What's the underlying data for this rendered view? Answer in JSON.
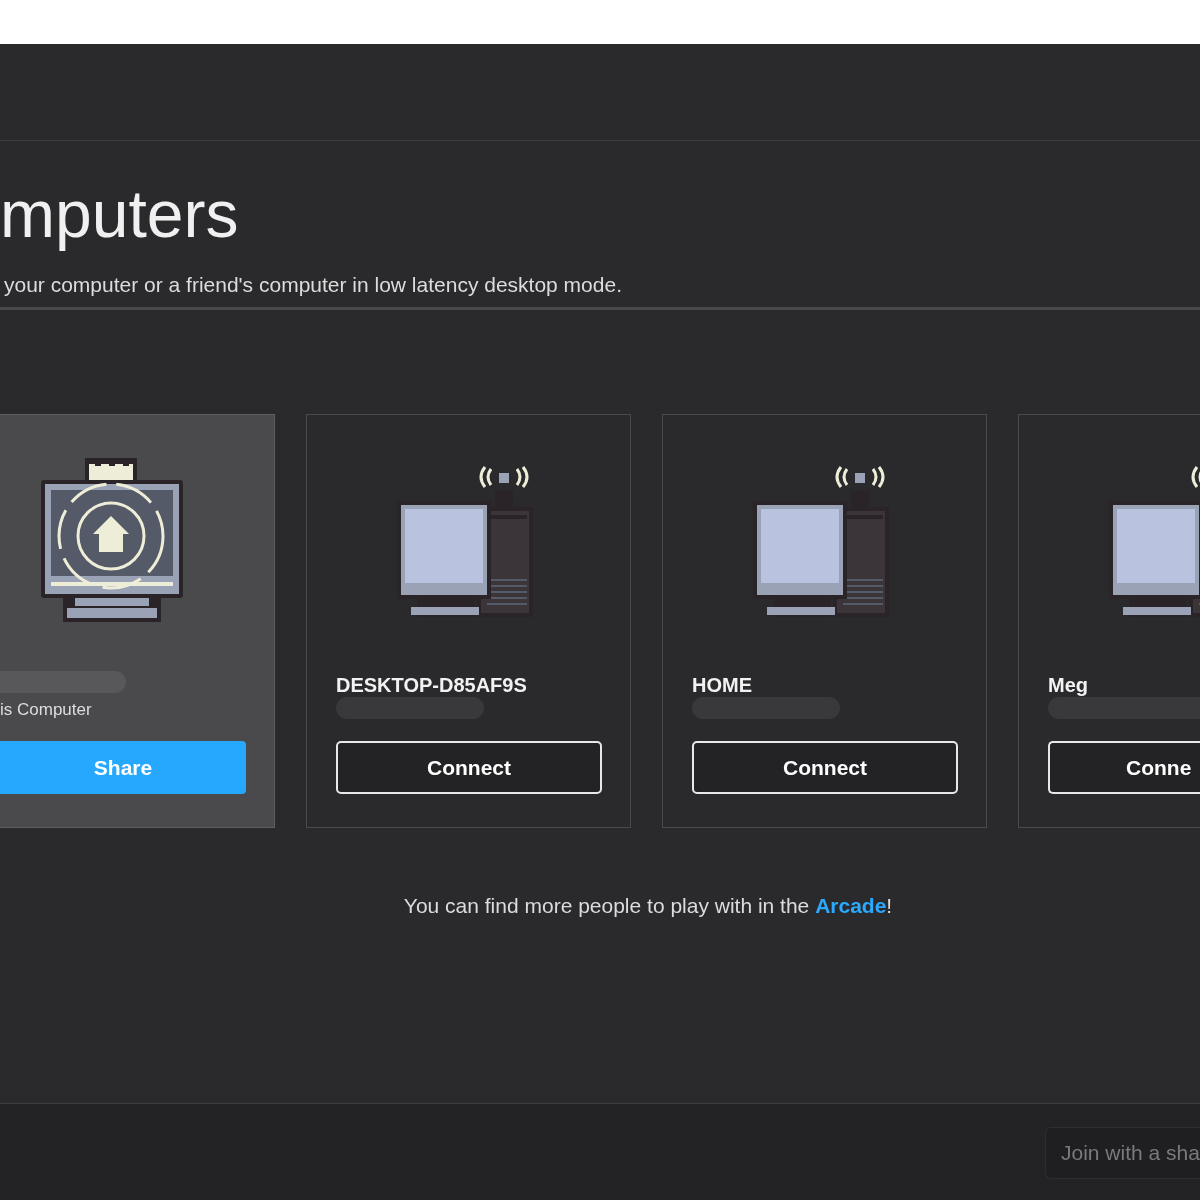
{
  "header": {
    "title": "mputers",
    "subtitle": "your computer or a friend's computer in low latency desktop mode."
  },
  "computers": [
    {
      "kind": "host",
      "label": "is Computer",
      "button": "Share"
    },
    {
      "kind": "remote",
      "name": "DESKTOP-D85AF9S",
      "button": "Connect"
    },
    {
      "kind": "remote",
      "name": "HOME",
      "button": "Connect"
    },
    {
      "kind": "remote",
      "name": "Meg",
      "button": "Conne"
    }
  ],
  "note": {
    "text_before": "You can find more people to play with in the ",
    "link": "Arcade",
    "text_after": "!"
  },
  "footer": {
    "join_field": {
      "placeholder": "Join with a sha"
    }
  }
}
